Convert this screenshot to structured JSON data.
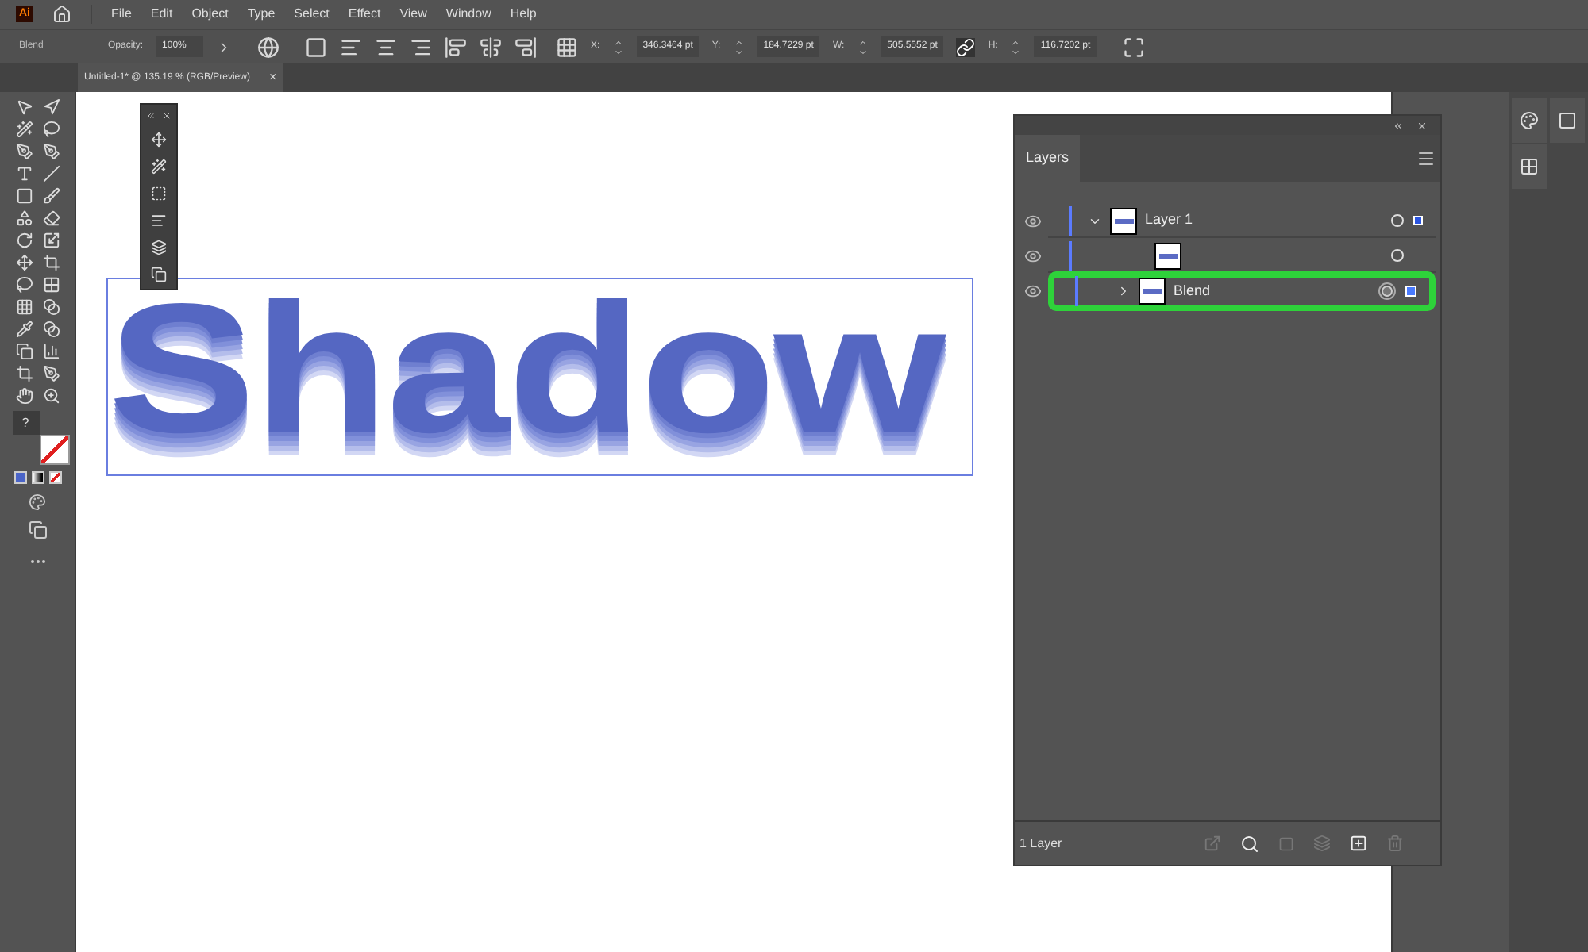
{
  "app": {
    "logo": "Ai",
    "menu": [
      "File",
      "Edit",
      "Object",
      "Type",
      "Select",
      "Effect",
      "View",
      "Window",
      "Help"
    ]
  },
  "control_bar": {
    "selection": "Blend",
    "opacity_label": "Opacity:",
    "opacity": "100%",
    "fields": [
      {
        "label": "X:",
        "value": "346.3464 pt"
      },
      {
        "label": "Y:",
        "value": "184.7229 pt"
      },
      {
        "label": "W:",
        "value": "505.5552 pt"
      },
      {
        "label": "H:",
        "value": "116.7202 pt"
      }
    ]
  },
  "document_tab": {
    "title": "Untitled-1* @ 135.19 % (RGB/Preview)",
    "close": "×"
  },
  "tools": {
    "help": "?"
  },
  "artwork": {
    "text": "Shadow"
  },
  "layers_panel": {
    "tab": "Layers",
    "rows": [
      {
        "name": "Layer 1",
        "kind": "layer",
        "expanded": true,
        "visible": true,
        "targeted": false,
        "selected": false
      },
      {
        "kind": "object",
        "visible": true,
        "targeted": false,
        "selected": false
      },
      {
        "name": "Blend",
        "kind": "group",
        "expanded": false,
        "visible": true,
        "targeted": true,
        "selected": true
      }
    ],
    "footer": "1 Layer"
  }
}
